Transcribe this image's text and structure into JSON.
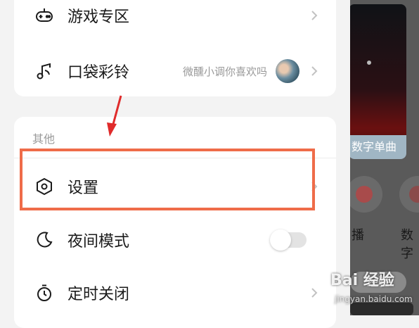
{
  "drawer": {
    "rows": [
      {
        "label": "游戏专区",
        "icon": "gamepad-icon"
      },
      {
        "label": "口袋彩铃",
        "sub": "微醺小调你喜欢吗",
        "icon": "music-note-icon"
      }
    ],
    "section_title": "其他",
    "others": [
      {
        "label": "设置",
        "icon": "settings-hexagon-icon"
      },
      {
        "label": "夜间模式",
        "icon": "moon-icon",
        "toggle_on": false
      },
      {
        "label": "定时关闭",
        "icon": "timer-icon"
      }
    ]
  },
  "background": {
    "banner_text": "数字单曲",
    "icon_label_1": "播",
    "icon_label_2": "数字",
    "pill_text": "经验"
  },
  "watermark": {
    "text": "Bai 经验",
    "sub": "jingyan.baidu.com"
  },
  "colors": {
    "highlight": "#ef6c49",
    "arrow": "#e02b2b",
    "text_primary": "#1b1b1b",
    "text_secondary": "#9a9a9a"
  }
}
